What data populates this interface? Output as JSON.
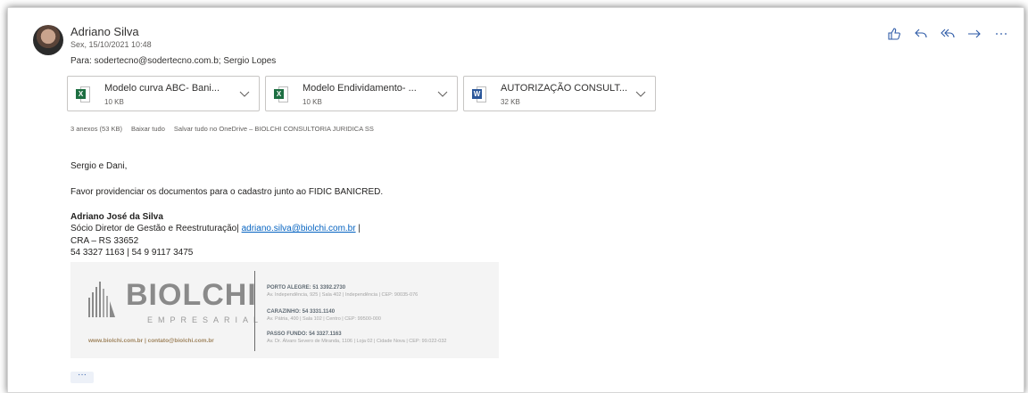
{
  "email": {
    "sender": "Adriano Silva",
    "date": "Sex, 15/10/2021 10:48",
    "to": "Para:  sodertecno@sodertecno.com.b; Sergio Lopes"
  },
  "actions": [
    {
      "name": "like-icon"
    },
    {
      "name": "reply-icon"
    },
    {
      "name": "reply-all-icon"
    },
    {
      "name": "forward-icon"
    },
    {
      "name": "more-actions-icon"
    }
  ],
  "attachments": [
    {
      "name": "Modelo curva ABC- Bani...",
      "size": "10 KB",
      "type": "excel"
    },
    {
      "name": "Modelo Endividamento- ...",
      "size": "10 KB",
      "type": "excel"
    },
    {
      "name": "AUTORIZAÇÃO CONSULT...",
      "size": "32 KB",
      "type": "word"
    }
  ],
  "attachment_meta": {
    "count": "3 anexos (53 KB)",
    "download_all": "Baixar tudo",
    "save_onedrive": "Salvar tudo no OneDrive – BIOLCHI CONSULTORIA JURIDICA SS"
  },
  "body": {
    "greeting": "Sergio e Dani,",
    "message": "Favor providenciar os documentos para o cadastro junto ao FIDIC BANICRED."
  },
  "signature": {
    "name": "Adriano José da Silva",
    "role": "Sócio Diretor de Gestão e Reestruturação| ",
    "email": "adriano.silva@biolchi.com.br",
    "role_suffix": " |",
    "cra": "CRA – RS 33652",
    "phones": "54 3327 1163 | 54 9 9117 3475"
  },
  "logo": {
    "word": "BIOLCHI",
    "sub": "EMPRESARIAL",
    "web": "www.biolchi.com.br | contato@biolchi.com.br",
    "offices": [
      {
        "city": "PORTO ALEGRE: 51 3392.2730",
        "addr": "Av. Independência, 925 | Sala 402 | Independência | CEP: 90035-076"
      },
      {
        "city": "CARAZINHO: 54 3331.1140",
        "addr": "Av. Pátria, 400 | Sala 102 | Centro | CEP: 99500-000"
      },
      {
        "city": "PASSO FUNDO: 54 3327.1163",
        "addr": "Av. Dr. Álvaro Severo de Miranda, 1106 | Loja 02 | Cidade Nova | CEP: 99.022-032"
      }
    ]
  },
  "more_button": "···",
  "colors": {
    "accent": "#2d5aa7",
    "link": "#0563c1",
    "excel": "#1d6f42",
    "word": "#2b579a"
  }
}
